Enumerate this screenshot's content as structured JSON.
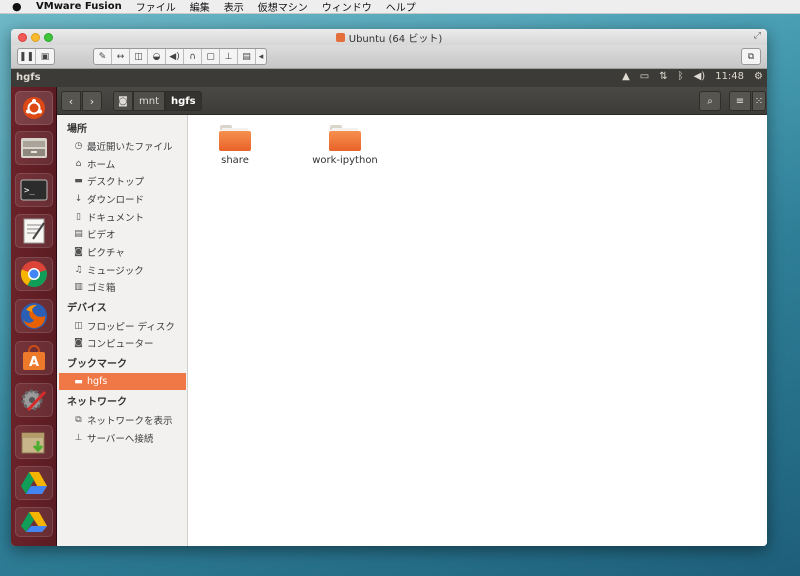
{
  "mac_menubar": {
    "app_name": "VMware Fusion",
    "menus": [
      "ファイル",
      "編集",
      "表示",
      "仮想マシン",
      "ウィンドウ",
      "ヘルプ"
    ]
  },
  "window": {
    "title": "Ubuntu (64 ビット)"
  },
  "ubuntu_panel": {
    "title": "hgfs",
    "clock": "11:48"
  },
  "launcher": {
    "items": [
      "ubuntu-dash-icon",
      "files-icon",
      "terminal-icon",
      "text-editor-icon",
      "chrome-icon",
      "firefox-icon",
      "software-center-icon",
      "system-settings-icon",
      "archive-manager-icon",
      "google-drive-icon",
      "google-drive-2-icon"
    ]
  },
  "path_bar": {
    "crumbs": [
      "mnt",
      "hgfs"
    ]
  },
  "sidebar": {
    "places_heading": "場所",
    "places": [
      "最近開いたファイル",
      "ホーム",
      "デスクトップ",
      "ダウンロード",
      "ドキュメント",
      "ビデオ",
      "ピクチャ",
      "ミュージック",
      "ゴミ箱"
    ],
    "devices_heading": "デバイス",
    "devices": [
      "フロッピー ディスク",
      "コンピューター"
    ],
    "bookmarks_heading": "ブックマーク",
    "bookmarks": [
      "hgfs"
    ],
    "network_heading": "ネットワーク",
    "network": [
      "ネットワークを表示",
      "サーバーへ接続"
    ]
  },
  "content": {
    "folders": [
      "share",
      "work-ipython"
    ]
  },
  "colors": {
    "accent": "#f07746",
    "launcher_bg": "#6a2229",
    "panel_bg": "#3c3b37"
  }
}
